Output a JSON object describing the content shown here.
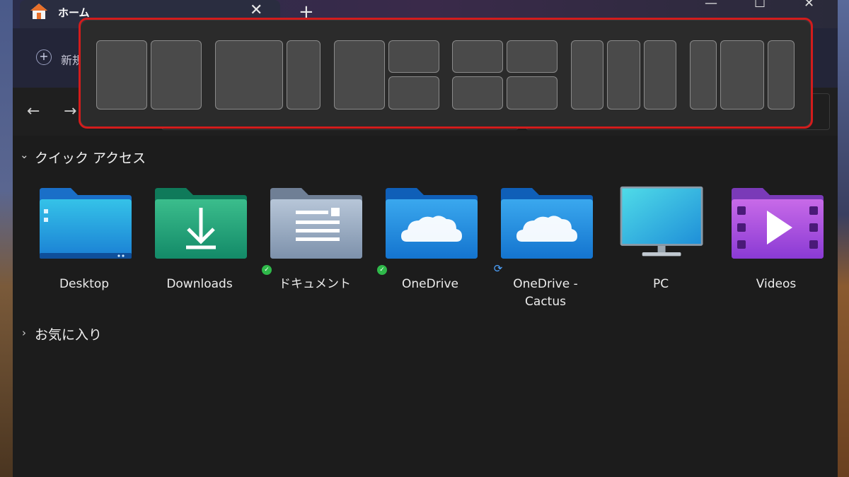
{
  "tab": {
    "title": "ホーム",
    "close_glyph": "✕",
    "new_tab_glyph": "+"
  },
  "window_controls": {
    "minimize": "—",
    "maximize": "☐",
    "close": "✕"
  },
  "toolbar": {
    "new_label": "新規",
    "new_icon": "plus-circle-icon"
  },
  "nav": {
    "back": "←",
    "forward": "→"
  },
  "snap_layouts": [
    {
      "name": "two-equal",
      "zones": 2
    },
    {
      "name": "two-wide-narrow",
      "zones": 2
    },
    {
      "name": "one-plus-two-stacked",
      "zones": 3
    },
    {
      "name": "grid-four",
      "zones": 4
    },
    {
      "name": "three-equal",
      "zones": 3
    },
    {
      "name": "three-narrow-wide-narrow",
      "zones": 3
    }
  ],
  "quick_access": {
    "title": "クイック アクセス",
    "chevron": "⌄",
    "items": [
      {
        "label": "Desktop",
        "icon": "desktop-folder-icon",
        "status": ""
      },
      {
        "label": "Downloads",
        "icon": "downloads-folder-icon",
        "status": ""
      },
      {
        "label": "ドキュメント",
        "icon": "documents-folder-icon",
        "status": "synced"
      },
      {
        "label": "OneDrive",
        "icon": "onedrive-folder-icon",
        "status": "synced"
      },
      {
        "label": "OneDrive -",
        "label2": "Cactus",
        "icon": "onedrive-folder-icon",
        "status": "syncing"
      },
      {
        "label": "PC",
        "icon": "monitor-icon",
        "status": ""
      },
      {
        "label": "Videos",
        "icon": "videos-folder-icon",
        "status": ""
      }
    ]
  },
  "favorites": {
    "title": "お気に入り",
    "chevron": "›"
  },
  "colors": {
    "highlight": "#d31c1c",
    "synced": "#2fb94a",
    "syncing": "#4da3ff"
  }
}
